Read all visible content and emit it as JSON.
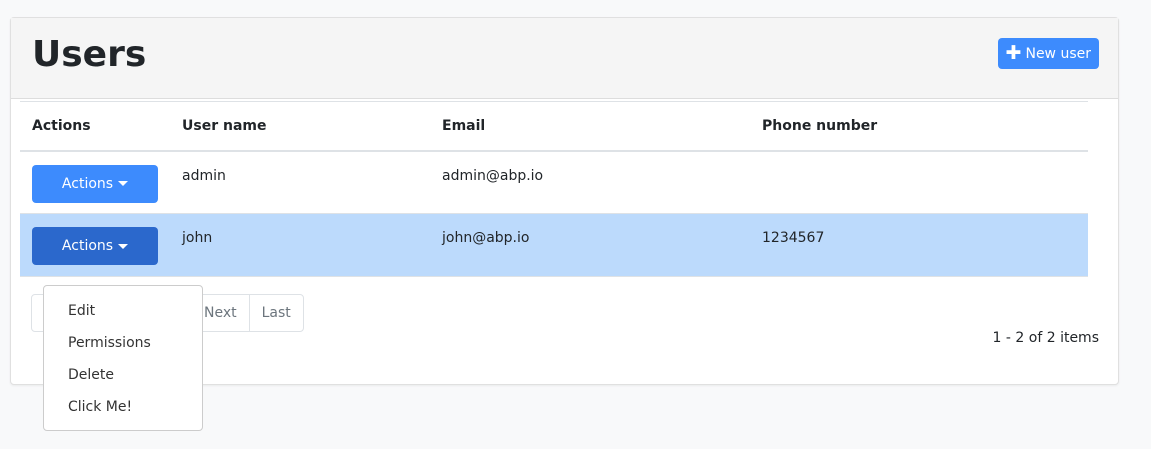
{
  "header": {
    "title": "Users",
    "new_user_label": "New user"
  },
  "table": {
    "columns": [
      "Actions",
      "User name",
      "Email",
      "Phone number"
    ],
    "rows": [
      {
        "action_label": "Actions",
        "username": "admin",
        "email": "admin@abp.io",
        "phone": ""
      },
      {
        "action_label": "Actions",
        "username": "john",
        "email": "john@abp.io",
        "phone": "1234567",
        "selected": true
      }
    ]
  },
  "pagination": {
    "next": "Next",
    "last": "Last",
    "summary": "1 - 2 of 2 items"
  },
  "dropdown": {
    "items": [
      "Edit",
      "Permissions",
      "Delete",
      "Click Me!"
    ]
  },
  "colors": {
    "primary": "#3d8bfd",
    "selected_row": "#bcdafc"
  }
}
